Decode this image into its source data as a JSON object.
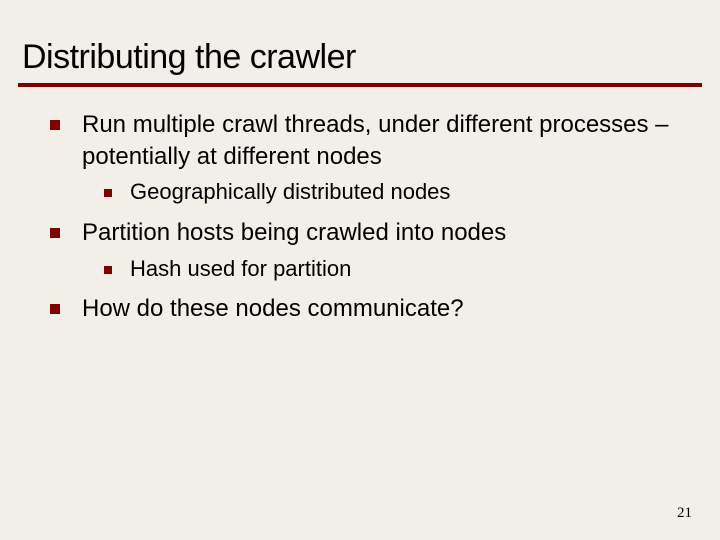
{
  "title": "Distributing the crawler",
  "bullets": [
    {
      "text": "Run multiple crawl threads, under different processes – potentially at different nodes",
      "sub": [
        {
          "text": "Geographically distributed nodes"
        }
      ]
    },
    {
      "text": "Partition hosts being crawled into nodes",
      "sub": [
        {
          "text": "Hash used for partition"
        }
      ]
    },
    {
      "text": "How do these nodes communicate?",
      "sub": []
    }
  ],
  "page_number": "21"
}
